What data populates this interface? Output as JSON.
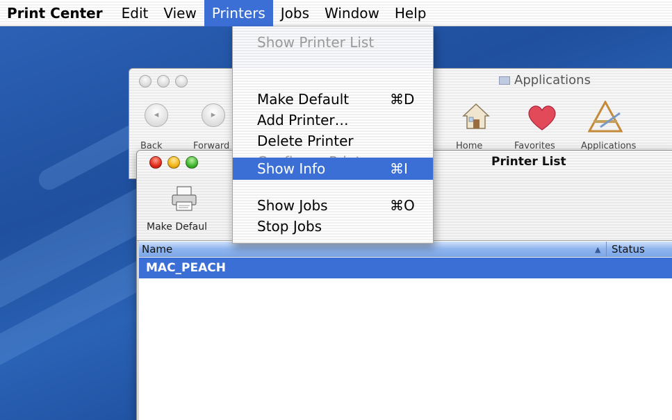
{
  "menubar": {
    "app": "Print Center",
    "items": [
      "Edit",
      "View",
      "Printers",
      "Jobs",
      "Window",
      "Help"
    ]
  },
  "printers_menu": {
    "items": [
      {
        "label": "Show Printer List",
        "shortcut": "",
        "enabled": false
      },
      {
        "label": "Make Default",
        "shortcut": "⌘D",
        "enabled": true
      },
      {
        "label": "Add Printer…",
        "shortcut": "",
        "enabled": true
      },
      {
        "label": "Delete Printer",
        "shortcut": "",
        "enabled": true
      },
      {
        "label": "Configure Printer",
        "shortcut": "",
        "enabled": false
      },
      {
        "label": "Show Info",
        "shortcut": "⌘I",
        "enabled": true,
        "highlighted": true
      },
      {
        "label": "Show Jobs",
        "shortcut": "⌘O",
        "enabled": true
      },
      {
        "label": "Stop Jobs",
        "shortcut": "",
        "enabled": true
      }
    ]
  },
  "finder_window": {
    "title": "Applications",
    "toolbar": [
      "Back",
      "Forward",
      "Home",
      "Favorites",
      "Applications"
    ]
  },
  "printer_list_window": {
    "title": "Printer List",
    "toolbar_button": "Make Defaul",
    "columns": {
      "name": "Name",
      "status": "Status"
    },
    "rows": [
      {
        "name": "MAC_PEACH",
        "selected": true
      }
    ]
  },
  "colors": {
    "selection": "#3b6fd6",
    "desktop": "#2558aa"
  }
}
